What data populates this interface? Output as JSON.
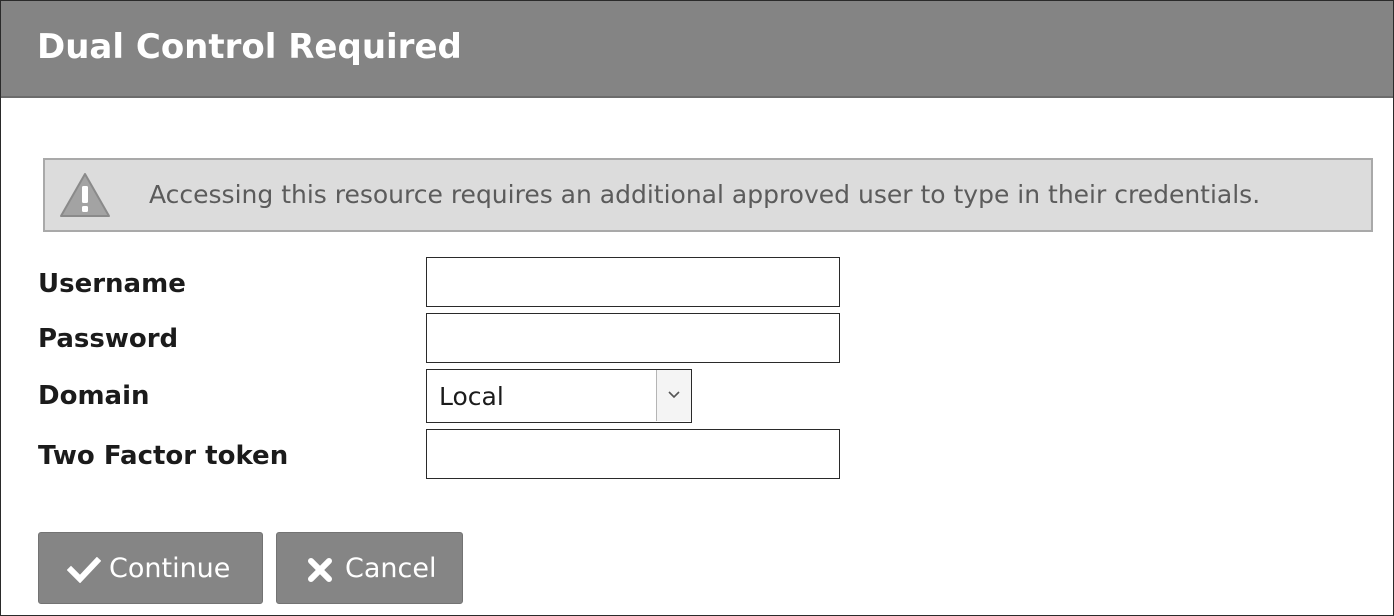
{
  "dialog": {
    "title": "Dual Control Required",
    "notice": {
      "icon": "warning-icon",
      "text": "Accessing this resource requires an additional approved user to type in their credentials."
    }
  },
  "form": {
    "username": {
      "label": "Username",
      "value": ""
    },
    "password": {
      "label": "Password",
      "value": ""
    },
    "domain": {
      "label": "Domain",
      "selected": "Local"
    },
    "two_factor": {
      "label": "Two Factor token",
      "value": ""
    }
  },
  "buttons": {
    "continue": {
      "label": "Continue",
      "icon": "checkmark-icon"
    },
    "cancel": {
      "label": "Cancel",
      "icon": "x-icon"
    }
  },
  "colors": {
    "title_bar": "#848484",
    "notice_bg": "#dcdcdc",
    "button_bg": "#858585"
  }
}
